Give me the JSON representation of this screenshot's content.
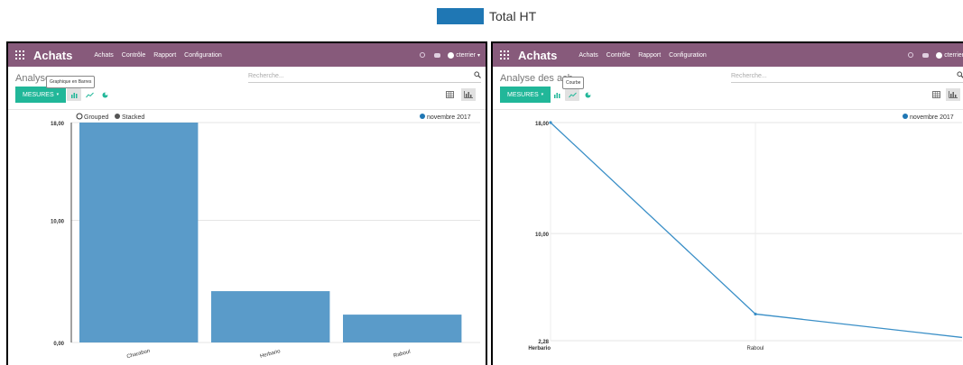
{
  "legend": {
    "label": "Total HT",
    "color": "#1f77b4"
  },
  "panels": [
    {
      "app": {
        "brand": "Achats",
        "menus": [
          "Achats",
          "Contrôle",
          "Rapport",
          "Configuration"
        ],
        "user": "cterrier"
      },
      "control": {
        "breadcrumb": "Analyse",
        "search_placeholder": "Recherche...",
        "mesures_label": "MESURES",
        "tooltip": "Graphique en Barres",
        "active_chart": "bar"
      },
      "chart_data": {
        "type": "bar",
        "categories": [
          "Charabon",
          "Herbario",
          "Raboul"
        ],
        "values": [
          18.0,
          4.2,
          2.28
        ],
        "series": [
          {
            "name": "novembre 2017",
            "values": [
              18.0,
              4.2,
              2.28
            ]
          }
        ],
        "tick_labels": [
          "0,00",
          "10,00",
          "18,00"
        ],
        "ylim": [
          0,
          18
        ],
        "bar_color": "#5a9bc9",
        "toggle": {
          "grouped": "Grouped",
          "stacked": "Stacked"
        },
        "legend_position": "top-right"
      }
    },
    {
      "app": {
        "brand": "Achats",
        "menus": [
          "Achats",
          "Contrôle",
          "Rapport",
          "Configuration"
        ],
        "user": "cterrier"
      },
      "control": {
        "breadcrumb": "Analyse des ach",
        "search_placeholder": "Recherche...",
        "mesures_label": "MESURES",
        "tooltip": "Courbe",
        "active_chart": "line"
      },
      "chart_data": {
        "type": "line",
        "categories": [
          "Herbario",
          "Raboul"
        ],
        "values": [
          18.0,
          4.2
        ],
        "series": [
          {
            "name": "novembre 2017",
            "values": [
              18.0,
              4.2
            ]
          }
        ],
        "tick_labels": [
          "2,28",
          "10,00",
          "18,00"
        ],
        "ylim": [
          2.28,
          18
        ],
        "line_color": "#3a8fc7",
        "legend_position": "top-right"
      }
    }
  ]
}
